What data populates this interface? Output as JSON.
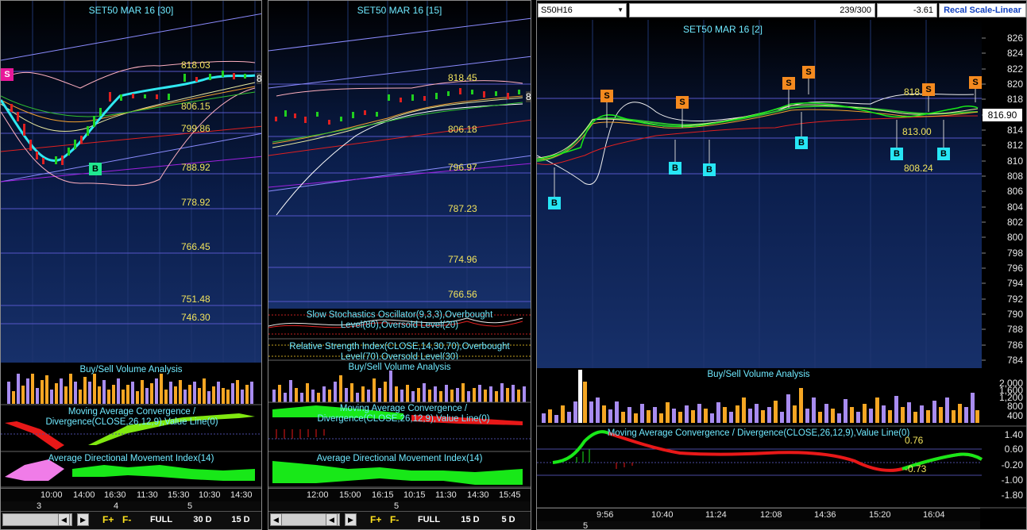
{
  "left_pane": {
    "title": "SET50 MAR 16  [30]",
    "levels": [
      "818.03",
      "806.15",
      "799.86",
      "788.92",
      "778.92",
      "766.45",
      "751.48",
      "746.30"
    ],
    "signals": {
      "s": "S",
      "b": "B"
    },
    "edge_label": "8",
    "volume_label": "Buy/Sell Volume Analysis",
    "macd_label": "Moving Average Convergence / Divergence(CLOSE,26,12,9),Value Line(0)",
    "adx_label": "Average Directional Movement Index(14)",
    "time_labels": [
      "10:00",
      "14:00",
      "16:30",
      "11:30",
      "15:30",
      "10:30",
      "14:30"
    ],
    "date_labels": [
      "3",
      "4",
      "5"
    ],
    "toolbar": {
      "f_plus": "F+",
      "f_minus": "F-",
      "full": "FULL",
      "range1": "30 D",
      "range2": "15 D"
    }
  },
  "mid_pane": {
    "title": "SET50 MAR 16  [15]",
    "levels": [
      "818.45",
      "806.18",
      "796.97",
      "787.23",
      "774.96",
      "766.56"
    ],
    "edge_label": "8",
    "stoch_label": "Slow Stochastics Oscillator(9,3,3),Overbought Level(80),Oversold Level(20)",
    "rsi_label": "Relative Strength Index(CLOSE,14,30,70),Overbought Level(70),Oversold Level(30)",
    "volume_label": "Buy/Sell Volume Analysis",
    "macd_label": "Moving Average Convergence / Divergence(CLOSE,26,12,9),Value Line(0)",
    "adx_label": "Average Directional Movement Index(14)",
    "time_labels": [
      "12:00",
      "15:00",
      "16:15",
      "10:15",
      "11:30",
      "14:30",
      "15:45"
    ],
    "date_labels": [
      "5"
    ],
    "toolbar": {
      "f_plus": "F+",
      "f_minus": "F-",
      "full": "FULL",
      "range1": "15 D",
      "range2": "5 D"
    }
  },
  "right_pane": {
    "symbol": "S50H16",
    "counter": "239/300",
    "change": "-3.61",
    "recal_button": "Recal Scale-Linear",
    "title": "SET50 MAR 16  [2]",
    "levels": [
      "818.",
      "813.00",
      "808.24"
    ],
    "last_price": "816.90",
    "y_ticks": [
      "826",
      "824",
      "822",
      "820",
      "818",
      "816",
      "814",
      "812",
      "810",
      "808",
      "806",
      "804",
      "802",
      "800",
      "798",
      "796",
      "794",
      "792",
      "790",
      "788",
      "786",
      "784"
    ],
    "signals": {
      "s": "S",
      "b": "B"
    },
    "volume_label": "Buy/Sell Volume Analysis",
    "volume_ticks": [
      "2,000",
      "1,600",
      "1,200",
      "800",
      "400"
    ],
    "macd_label": "Moving Average Convergence / Divergence(CLOSE,26,12,9),Value Line(0)",
    "macd_values": [
      "0.76",
      "-0.73"
    ],
    "macd_ticks": [
      "1.40",
      "0.60",
      "-0.20",
      "-1.00",
      "-1.80"
    ],
    "time_labels": [
      "9:56",
      "10:40",
      "11:24",
      "12:08",
      "14:36",
      "15:20",
      "16:04"
    ],
    "date_labels": [
      "5"
    ]
  },
  "colors": {
    "bg": "#000000",
    "grid": "#1c2f6b",
    "title": "#6fe9ff",
    "level": "#f2e35c",
    "sell": "#f58a1f",
    "buy": "#27e6f5",
    "volume_buy": "#f5a623",
    "volume_sell": "#a88cf0",
    "macd_up": "#18e818",
    "macd_down": "#e81818"
  }
}
